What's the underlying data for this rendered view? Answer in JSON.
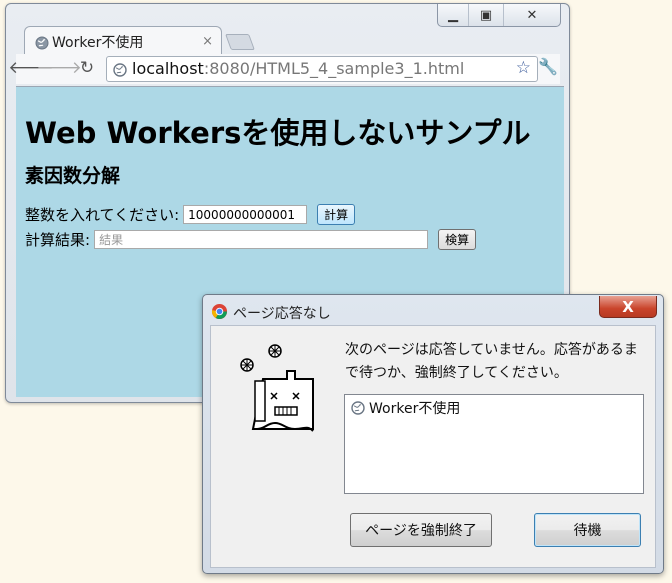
{
  "browser": {
    "tab_title": "Worker不使用",
    "tab_close": "×",
    "url_host": "localhost",
    "url_rest": ":8080/HTML5_4_sample3_1.html"
  },
  "page": {
    "heading": "Web Workersを使用しないサンプル",
    "subheading": "素因数分解",
    "input_label": "整数を入れてください:",
    "input_value": "10000000000001",
    "calc_button": "計算",
    "result_label": "計算結果:",
    "result_placeholder": "結果",
    "check_button": "検算"
  },
  "dialog": {
    "title": "ページ応答なし",
    "message": "次のページは応答していません。応答があるまで待つか、強制終了してください。",
    "pages": [
      "Worker不使用"
    ],
    "kill_button": "ページを強制終了",
    "wait_button": "待機",
    "close": "X"
  }
}
